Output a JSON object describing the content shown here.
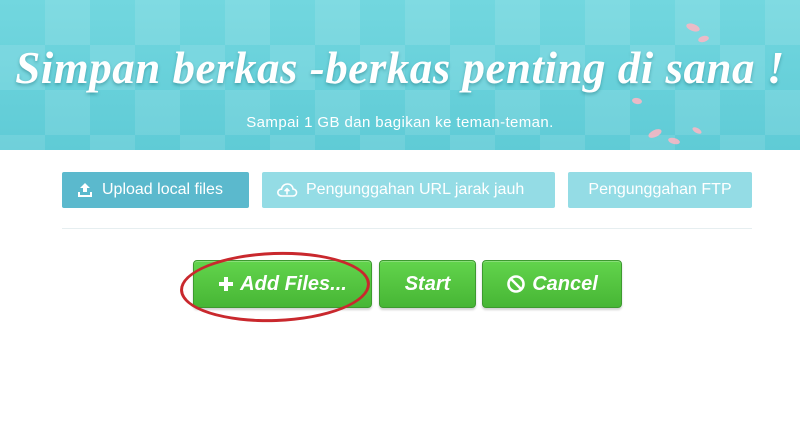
{
  "banner": {
    "headline": "Simpan berkas -berkas penting di sana !",
    "subline": "Sampai 1 GB dan bagikan ke teman-teman."
  },
  "tabs": [
    {
      "label": "Upload local files",
      "icon": "upload-icon",
      "active": true
    },
    {
      "label": "Pengunggahan URL jarak jauh",
      "icon": "cloud-upload-icon",
      "active": false
    },
    {
      "label": "Pengunggahan FTP",
      "icon": "",
      "active": false
    }
  ],
  "actions": {
    "add_files": {
      "label": "Add Files...",
      "icon": "plus-icon"
    },
    "start": {
      "label": "Start"
    },
    "cancel": {
      "label": "Cancel",
      "icon": "ban-icon"
    }
  },
  "colors": {
    "banner": "#6dd3dc",
    "tab_active": "#5bb9cd",
    "tab_inactive": "#94dce5",
    "button_green": "#4fc23b",
    "highlight_red": "#c9282d"
  }
}
